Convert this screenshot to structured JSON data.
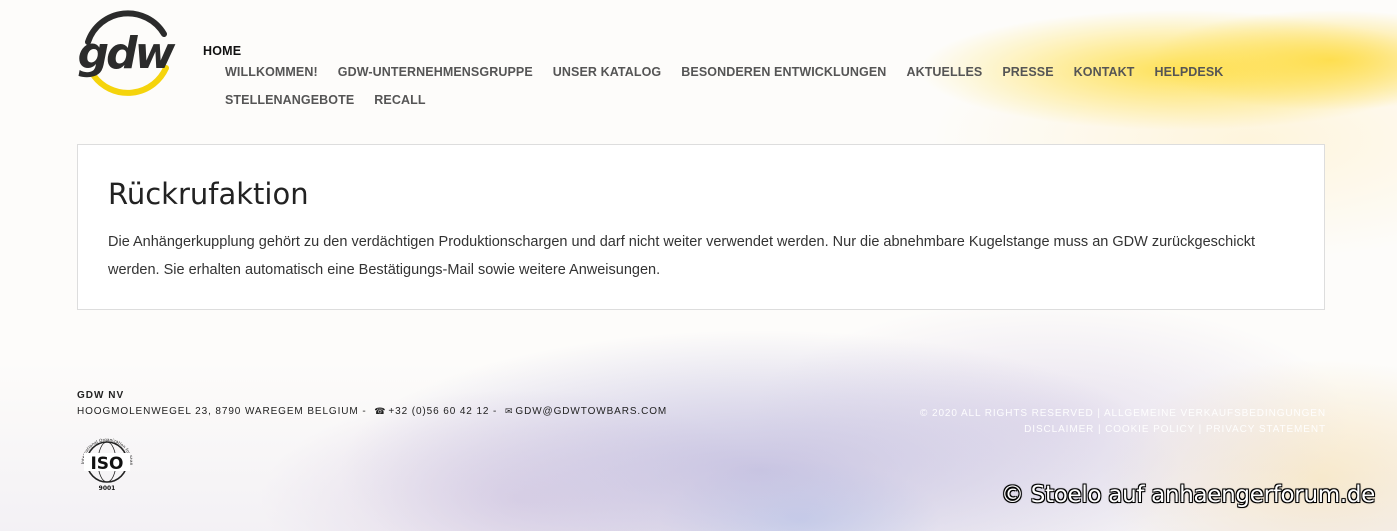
{
  "brand": {
    "logo_text": "gdw",
    "logo_colors": {
      "ring": "#2b2b2b",
      "accent": "#f5d40c"
    }
  },
  "nav": {
    "home": "HOME",
    "items": [
      "WILLKOMMEN!",
      "GDW-UNTERNEHMENSGRUPPE",
      "UNSER KATALOG",
      "BESONDEREN ENTWICKLUNGEN",
      "AKTUELLES",
      "PRESSE",
      "KONTAKT",
      "HELPDESK",
      "STELLENANGEBOTE",
      "RECALL"
    ]
  },
  "main": {
    "title": "Rückrufaktion",
    "body": "Die Anhängerkupplung gehört zu den verdächtigen Produktionschargen und darf nicht weiter verwendet werden. Nur die abnehmbare Kugelstange muss an GDW zurückgeschickt werden. Sie erhalten automatisch eine Bestätigungs-Mail sowie weitere Anweisungen."
  },
  "footer": {
    "company": "GDW NV",
    "address": "HOOGMOLENWEGEL 23, 8790 WAREGEM BELGIUM -",
    "phone_icon": "phone-icon",
    "phone": "+32 (0)56 60 42 12 -",
    "mail_icon": "mail-icon",
    "email": "GDW@GDWTOWBARS.COM",
    "iso": {
      "label": "ISO",
      "number": "9001",
      "arc_text": "International Organization for Standardization"
    },
    "rights": "© 2020 ALL RIGHTS RESERVED | ALLGEMEINE VERKAUFSBEDINGUNGEN",
    "legal": "DISCLAIMER | COOKIE POLICY | PRIVACY STATEMENT"
  },
  "watermark": "© Stoelo auf anhaengerforum.de"
}
